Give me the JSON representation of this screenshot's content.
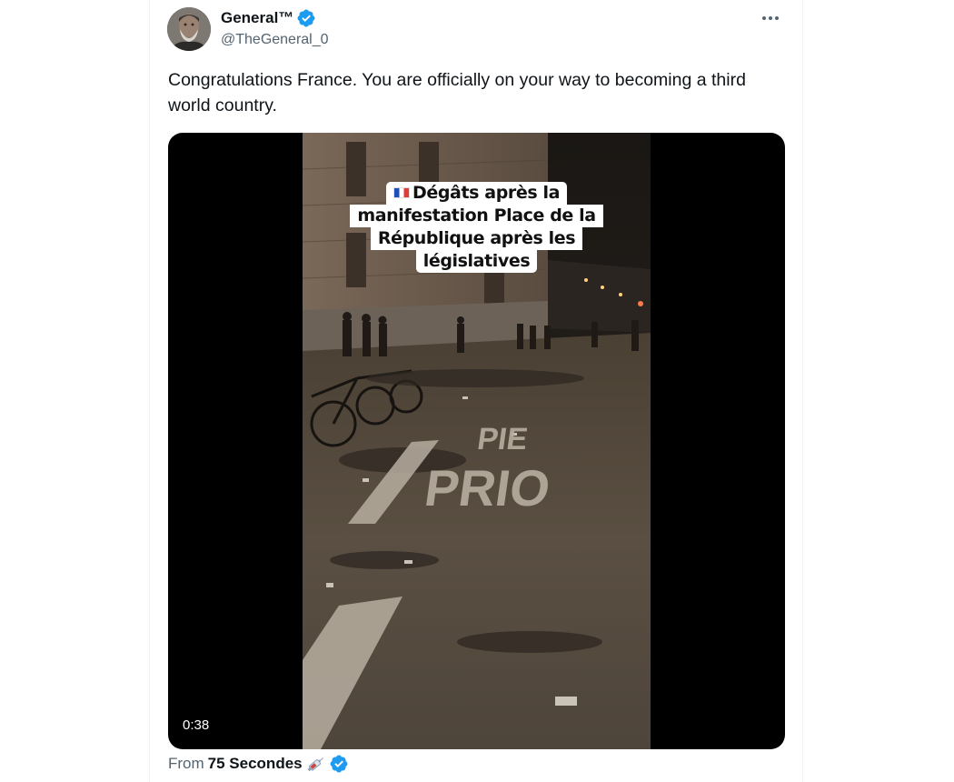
{
  "author": {
    "display_name": "General™",
    "handle": "@TheGeneral_0",
    "verified": true,
    "avatar_icon": "profile-photo"
  },
  "more_icon": "more-options-icon",
  "tweet": {
    "text": "Congratulations France. You are officially on your way to becoming a third world country."
  },
  "media": {
    "caption_lines": [
      "Dégâts après la",
      "manifestation Place de la",
      "République après les",
      "législatives"
    ],
    "caption_flag_icon": "france-flag-icon",
    "street_text": [
      "PIE",
      "PRIO"
    ],
    "duration": "0:38"
  },
  "source": {
    "prefix": "From",
    "name": "75 Secondes",
    "emoji_icon": "syringe-icon",
    "verified": true
  },
  "colors": {
    "verified_blue": "#1d9bf0",
    "text_primary": "#0f1419",
    "text_secondary": "#536471"
  }
}
